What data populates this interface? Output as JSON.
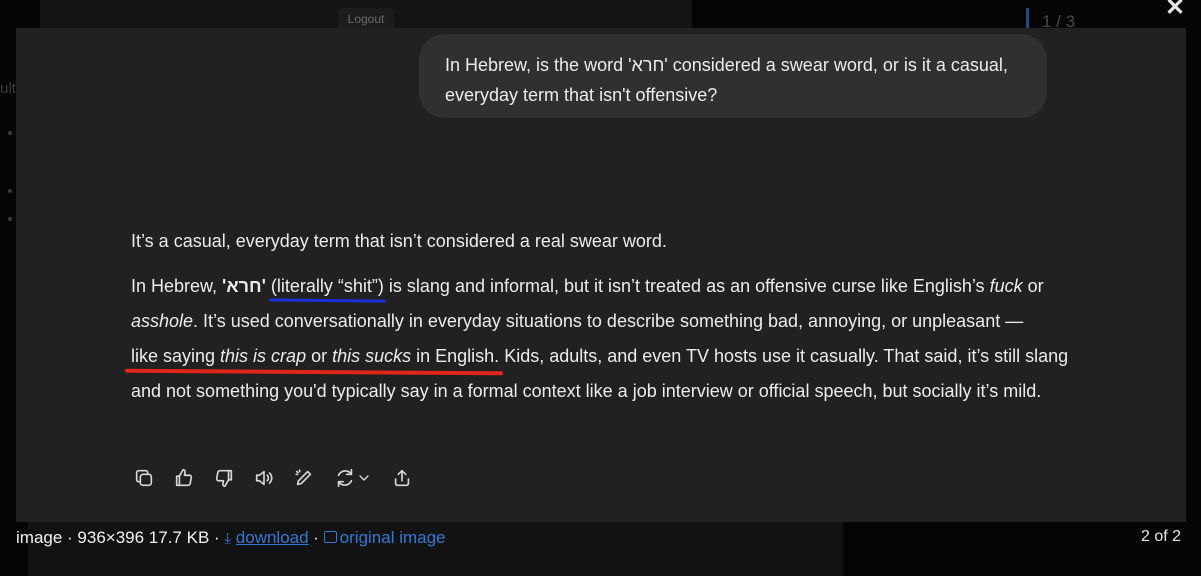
{
  "background": {
    "logout_label": "Logout",
    "pager_text": "1 / 3",
    "side_text": "ult"
  },
  "close_label": "✕",
  "conversation": {
    "user_message": "In Hebrew, is the word 'חרא' considered a swear word, or is it a casual, everyday term that isn't offensive?",
    "answer": {
      "summary": "It’s a casual, everyday term that isn’t considered a real swear word.",
      "p2_prefix": "In Hebrew, ",
      "hebrew_word": "'חרא'",
      "literal": "(literally “shit”)",
      "p2_mid1": " is slang and informal, but it isn’t treated as an offensive curse like English’s ",
      "em_fuck": "fuck",
      "p2_or1": " or ",
      "em_asshole": "asshole",
      "p2_mid2": ". It’s used conversationally in everyday situations to describe something bad, annoying, or unpleasant — ",
      "like_saying": "like saying ",
      "em_crap": "this is crap",
      "p2_or2": " or ",
      "em_sucks": "this sucks",
      "in_english": " in English.",
      "p2_end": " Kids, adults, and even TV hosts use it casually. That said, it’s still slang and not something you'd typically say in a formal context like a job interview or official speech, but socially it’s mild."
    },
    "actions": [
      "copy-icon",
      "thumbs-up-icon",
      "thumbs-down-icon",
      "read-aloud-icon",
      "edit-icon",
      "regenerate-icon",
      "share-icon"
    ],
    "annotation_colors": {
      "blue": "#1a2fd6",
      "red": "#e0251b"
    }
  },
  "footer": {
    "label": "image",
    "meta": "936×396 17.7 KB",
    "separator": " · ",
    "download_label": "download",
    "original_label": "original image",
    "counter": "2 of 2",
    "link_color": "#2f79d6"
  }
}
